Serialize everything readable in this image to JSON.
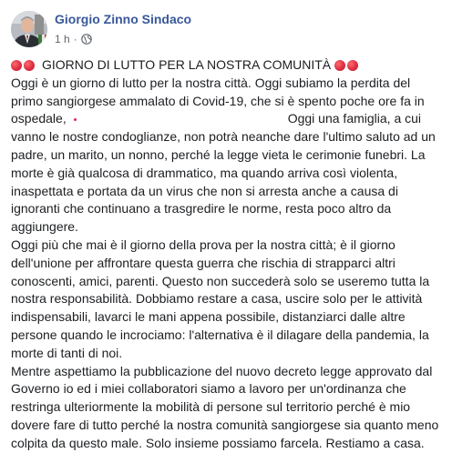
{
  "post": {
    "author": "Giorgio Zinno Sindaco",
    "timestamp": "1 h",
    "separator": "·",
    "headline": "GIORNO DI LUTTO PER LA NOSTRA COMUNITÀ",
    "paragraph1_a": "Oggi è un giorno di lutto per la nostra città. Oggi subiamo la perdita del primo sangiorgese ammalato di Covid-19, che si è spento poche ore fa in ospedale,",
    "paragraph1_b": "Oggi una famiglia, a cui vanno le nostre condoglianze, non potrà neanche dare l'ultimo saluto ad un padre, un marito, un nonno, perché la legge vieta le cerimonie funebri. La morte è già qualcosa di drammatico, ma quando arriva così violenta, inaspettata e portata da un virus che non si arresta anche a causa di ignoranti che continuano a trasgredire le norme, resta poco altro da aggiungere.",
    "paragraph2": "Oggi più che mai è il giorno della prova per la nostra città; è il giorno dell'unione per affrontare questa guerra che rischia di strapparci altri conoscenti, amici, parenti. Questo non succederà solo se useremo tutta la nostra responsabilità. Dobbiamo restare a casa, uscire solo per le attività indispensabili, lavarci le mani appena possibile, distanziarci dalle altre persone quando le incrociamo: l'alternativa è il dilagare della pandemia, la morte di tanti di noi.",
    "paragraph3": "Mentre aspettiamo la pubblicazione del nuovo decreto legge approvato dal Governo io ed i miei collaboratori siamo a lavoro per un'ordinanza che restringa ulteriormente la mobilità di persone sul territorio perché è mio dovere fare di tutto perché la nostra comunità sangiorgese sia quanto meno colpita da questo male. Solo insieme possiamo farcela. Restiamo a casa."
  },
  "icons": {
    "avatar": "profile-photo",
    "privacy": "globe-icon",
    "emoji": "red-circle"
  },
  "colors": {
    "author": "#385898",
    "text": "#1c1e21",
    "meta": "#606770",
    "red_circle": "#dd2e44"
  }
}
